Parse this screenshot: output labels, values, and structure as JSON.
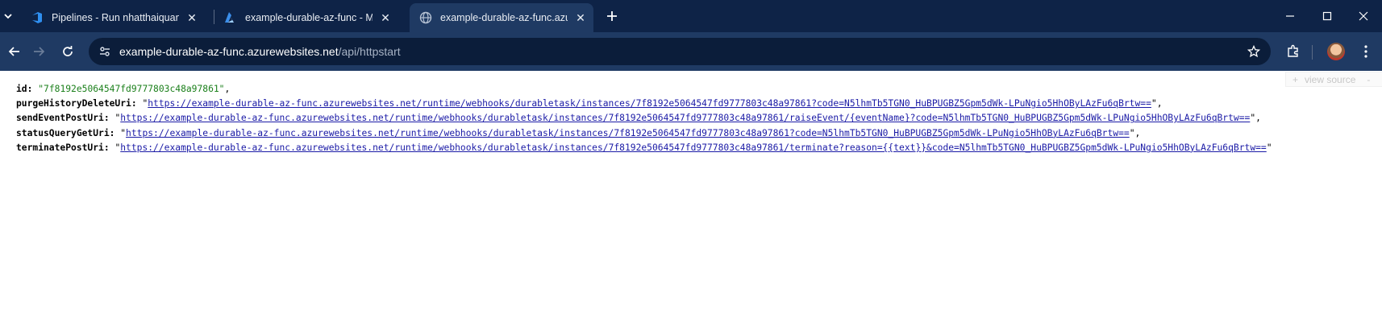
{
  "tabs": [
    {
      "title": "Pipelines - Run nhatthaiquang-devops-ci",
      "icon": "azure-devops-icon"
    },
    {
      "title": "example-durable-az-func - Microsoft Azure",
      "icon": "azure-icon"
    },
    {
      "title": "example-durable-az-func.azurewebsites.net",
      "icon": "globe-icon",
      "active": true
    }
  ],
  "address": {
    "host": "example-durable-az-func.azurewebsites.net",
    "path": "/api/httpstart"
  },
  "viewer": {
    "view_source": "view source"
  },
  "json": {
    "id_key": "id",
    "id_value": "\"7f8192e5064547fd9777803c48a97861\"",
    "purge_key": "purgeHistoryDeleteUri",
    "purge_url": "https://example-durable-az-func.azurewebsites.net/runtime/webhooks/durabletask/instances/7f8192e5064547fd9777803c48a97861?code=N5lhmTb5TGN0_HuBPUGBZ5Gpm5dWk-LPuNgio5HhOByLAzFu6qBrtw==",
    "sendevent_key": "sendEventPostUri",
    "sendevent_url": "https://example-durable-az-func.azurewebsites.net/runtime/webhooks/durabletask/instances/7f8192e5064547fd9777803c48a97861/raiseEvent/{eventName}?code=N5lhmTb5TGN0_HuBPUGBZ5Gpm5dWk-LPuNgio5HhOByLAzFu6qBrtw==",
    "status_key": "statusQueryGetUri",
    "status_url": "https://example-durable-az-func.azurewebsites.net/runtime/webhooks/durabletask/instances/7f8192e5064547fd9777803c48a97861?code=N5lhmTb5TGN0_HuBPUGBZ5Gpm5dWk-LPuNgio5HhOByLAzFu6qBrtw==",
    "terminate_key": "terminatePostUri",
    "terminate_url": "https://example-durable-az-func.azurewebsites.net/runtime/webhooks/durabletask/instances/7f8192e5064547fd9777803c48a97861/terminate?reason={{text}}&code=N5lhmTb5TGN0_HuBPUGBZ5Gpm5dWk-LPuNgio5HhOByLAzFu6qBrtw=="
  },
  "colors": {
    "tabstrip": "#0e2347",
    "toolbar": "#1f3a63",
    "json_string": "#1a7f1a",
    "json_link": "#1a1aa6"
  }
}
